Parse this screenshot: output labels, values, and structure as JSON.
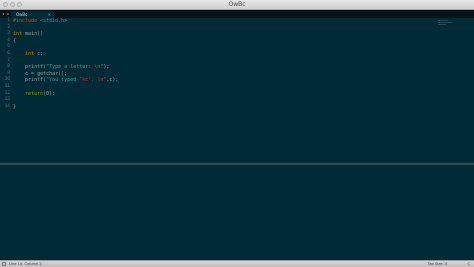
{
  "window": {
    "title": "OwBc"
  },
  "tabs": [
    {
      "label": "OwBc",
      "close": "×"
    }
  ],
  "tab_nav": "◂ ▸",
  "editor": {
    "line_numbers": [
      "1",
      "2",
      "3",
      "4",
      "5",
      "6",
      "7",
      "8",
      "9",
      "10",
      "11",
      "12",
      "13",
      "14"
    ],
    "lines": [
      [
        {
          "t": "#include ",
          "c": "pre"
        },
        {
          "t": "<stdio.h>",
          "c": "str"
        }
      ],
      [],
      [
        {
          "t": "int ",
          "c": "type"
        },
        {
          "t": "main",
          "c": "fn"
        },
        {
          "t": "()",
          "c": "plain"
        }
      ],
      [
        {
          "t": "{",
          "c": "plain"
        }
      ],
      [],
      [
        {
          "t": "    ",
          "c": "plain"
        },
        {
          "t": "int ",
          "c": "type"
        },
        {
          "t": "c;",
          "c": "plain"
        }
      ],
      [],
      [
        {
          "t": "    printf(",
          "c": "plain"
        },
        {
          "t": "\"Type a letter: ",
          "c": "str"
        },
        {
          "t": "\\n",
          "c": "esc"
        },
        {
          "t": "\"",
          "c": "str"
        },
        {
          "t": ");",
          "c": "plain"
        }
      ],
      [
        {
          "t": "    c = getchar();",
          "c": "plain"
        }
      ],
      [
        {
          "t": "    printf(",
          "c": "plain"
        },
        {
          "t": "\"You typed '",
          "c": "str"
        },
        {
          "t": "%c",
          "c": "esc"
        },
        {
          "t": "'. ",
          "c": "str"
        },
        {
          "t": "\\n",
          "c": "esc"
        },
        {
          "t": "\"",
          "c": "str"
        },
        {
          "t": ",c);",
          "c": "plain"
        }
      ],
      [],
      [
        {
          "t": "    ",
          "c": "plain"
        },
        {
          "t": "return",
          "c": "kw"
        },
        {
          "t": "(0);",
          "c": "plain"
        }
      ],
      [],
      [
        {
          "t": "}",
          "c": "plain"
        }
      ]
    ]
  },
  "status": {
    "position": "Line 14, Column 2",
    "tab_size": "Tab Size: 4",
    "syntax": "C"
  },
  "colors": {
    "background": "#002b36",
    "preprocessor": "#cb4b16",
    "type": "#b58900",
    "string": "#2aa198",
    "escape": "#dc322f",
    "keyword": "#859900",
    "plain": "#93a1a1"
  }
}
